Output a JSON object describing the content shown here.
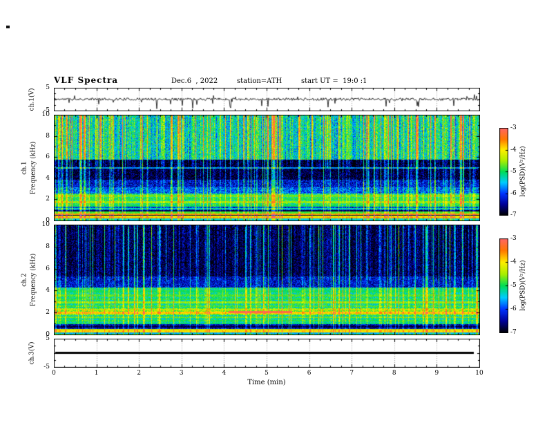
{
  "header": {
    "title": "VLF Spectra",
    "date": "Dec.6  , 2022",
    "station": "station=ATH",
    "start_ut": "start UT =  19:0 :1"
  },
  "x_axis": {
    "label": "Time  (min)",
    "ticks": [
      "0",
      "1",
      "2",
      "3",
      "4",
      "5",
      "6",
      "7",
      "8",
      "9",
      "10"
    ],
    "range": [
      0,
      10
    ]
  },
  "panels": {
    "ch1_wave": {
      "ylabel": "ch.1(V)",
      "yticks": [
        5,
        -5
      ],
      "y_range": [
        -5,
        5
      ]
    },
    "ch1_spec": {
      "ylabel_channel": "ch.1",
      "ylabel_axis": "Frequency (kHz)",
      "yticks": [
        10,
        8,
        6,
        4,
        2,
        0
      ],
      "y_range": [
        0,
        10
      ]
    },
    "ch2_spec": {
      "ylabel_channel": "ch.2",
      "ylabel_axis": "Frequency (kHz)",
      "yticks": [
        10,
        8,
        6,
        4,
        2,
        0
      ],
      "y_range": [
        0,
        10
      ]
    },
    "ch3_wave": {
      "ylabel": "ch.3(V)",
      "yticks": [
        5,
        -5
      ],
      "y_range": [
        -5,
        5
      ]
    }
  },
  "colorbar": {
    "label": "log(PSD)(V²/Hz)",
    "ticks": [
      -3,
      -4,
      -5,
      -6,
      -7
    ],
    "range": [
      -7,
      -3
    ]
  },
  "colors": {
    "background": "#ffffff",
    "frame": "#000000",
    "trace": "#000000",
    "grid_dotted": "#999999",
    "colormap_stops": [
      {
        "t": 0.0,
        "c": "#000000"
      },
      {
        "t": 0.125,
        "c": "#000099"
      },
      {
        "t": 0.25,
        "c": "#0033ff"
      },
      {
        "t": 0.375,
        "c": "#00ccff"
      },
      {
        "t": 0.5,
        "c": "#00dd55"
      },
      {
        "t": 0.625,
        "c": "#aaee00"
      },
      {
        "t": 0.75,
        "c": "#ffee00"
      },
      {
        "t": 0.875,
        "c": "#ff7700"
      },
      {
        "t": 1.0,
        "c": "#ff6666"
      }
    ]
  },
  "chart_data": [
    {
      "type": "line",
      "panel": "ch.1(V)",
      "x_range_min": [
        0,
        10
      ],
      "y_range_v": [
        -5,
        5
      ],
      "description": "Channel-1 broadband voltage: noise band around 0 V with frequent impulsive sferic spikes, mostly negative, reaching about -4 V",
      "baseline": 0,
      "noise_amplitude": 0.55,
      "spike_probability": 0.035,
      "spike_depth_range": [
        1.2,
        4.0
      ],
      "upspike_probability": 0.015,
      "upspike_height_range": [
        0.8,
        2.0
      ],
      "seed": 11
    },
    {
      "type": "heatmap",
      "panel": "ch.1 spectrogram",
      "x_range_min": [
        0,
        10
      ],
      "freq_range_khz": [
        0,
        10
      ],
      "z_label": "log(PSD)(V²/Hz)",
      "z_range": [
        -7,
        -3
      ],
      "description": "Green/cyan speckle above ~6 kHz with dense vertical sferic streaks; dark blue/black quiet band ~4-6 kHz; bright green band ~1.6-2.6 kHz; layered narrow horizontal lines (some red/yellow) below 1 kHz",
      "bands": [
        {
          "f": [
            5.8,
            10.01
          ],
          "level": -5.25
        },
        {
          "f": [
            3.9,
            5.8
          ],
          "level": -6.85
        },
        {
          "f": [
            3.2,
            3.9
          ],
          "level": -6.3
        },
        {
          "f": [
            2.55,
            3.2
          ],
          "level": -5.9
        },
        {
          "f": [
            1.55,
            2.55
          ],
          "level": -5.05
        },
        {
          "f": [
            0.95,
            1.55
          ],
          "level": -6.1
        },
        {
          "f": [
            0.45,
            0.95
          ],
          "level": -5.5
        },
        {
          "f": [
            0.0,
            0.45
          ],
          "level": -5.2
        }
      ],
      "lines": [
        {
          "f": 5.0,
          "level": -5.7
        },
        {
          "f": 2.35,
          "level": -4.7
        },
        {
          "f": 2.05,
          "level": -4.9
        },
        {
          "f": 1.75,
          "level": -4.55
        },
        {
          "f": 1.45,
          "level": -5.0
        },
        {
          "f": 1.15,
          "level": -5.3
        },
        {
          "f": 0.95,
          "level": -6.8
        },
        {
          "f": 0.8,
          "level": -4.8
        },
        {
          "f": 0.62,
          "level": -3.7
        },
        {
          "f": 0.5,
          "level": -6.9
        },
        {
          "f": 0.38,
          "level": -4.2
        },
        {
          "f": 0.25,
          "level": -3.8
        },
        {
          "f": 0.12,
          "level": -5.4
        }
      ],
      "streaks": {
        "probability": 0.24,
        "boost_min": 0.5,
        "boost_max": 2.3,
        "top_weight": 1.0,
        "bottom_weight": 0.55
      },
      "pixel_noise": 0.55,
      "column_variation": 0.5,
      "seed": 42
    },
    {
      "type": "heatmap",
      "panel": "ch.2 spectrogram",
      "x_range_min": [
        0,
        10
      ],
      "freq_range_khz": [
        0,
        10
      ],
      "z_label": "log(PSD)(V²/Hz)",
      "z_range": [
        -7,
        -3
      ],
      "description": "Dark blue/black background above ~5 kHz crossed by many cyan/green vertical sferic streaks; green band with yellow horizontal lines 2.5-4 kHz; strong yellow band near 2 kHz with a red segment around 4-5.6 min; dark band 0.55-1 kHz; bright layered lines below 0.5 kHz",
      "bands": [
        {
          "f": [
            5.3,
            10.01
          ],
          "level": -6.75
        },
        {
          "f": [
            4.3,
            5.3
          ],
          "level": -6.3
        },
        {
          "f": [
            2.45,
            4.3
          ],
          "level": -5.15
        },
        {
          "f": [
            1.8,
            2.45
          ],
          "level": -4.6
        },
        {
          "f": [
            1.0,
            1.8
          ],
          "level": -5.2
        },
        {
          "f": [
            0.55,
            1.0
          ],
          "level": -6.35
        },
        {
          "f": [
            0.0,
            0.55
          ],
          "level": -5.0
        }
      ],
      "lines": [
        {
          "f": 3.95,
          "level": -5.0
        },
        {
          "f": 3.6,
          "level": -4.8
        },
        {
          "f": 3.25,
          "level": -4.9
        },
        {
          "f": 2.95,
          "level": -4.6
        },
        {
          "f": 2.6,
          "level": -4.8
        },
        {
          "f": 2.3,
          "level": -4.45
        },
        {
          "f": 2.0,
          "level": -3.85
        },
        {
          "f": 2.08,
          "level": -3.2,
          "x_range": [
            4.1,
            5.6
          ]
        },
        {
          "f": 1.6,
          "level": -4.7
        },
        {
          "f": 1.3,
          "level": -4.9
        },
        {
          "f": 1.05,
          "level": -5.1
        },
        {
          "f": 0.75,
          "level": -6.8
        },
        {
          "f": 0.45,
          "level": -4.3
        },
        {
          "f": 0.3,
          "level": -3.95
        },
        {
          "f": 0.15,
          "level": -5.6
        }
      ],
      "streaks": {
        "probability": 0.2,
        "boost_min": 0.4,
        "boost_max": 2.0,
        "top_weight": 1.0,
        "bottom_weight": 0.5
      },
      "pixel_noise": 0.5,
      "column_variation": 0.3,
      "seed": 77
    },
    {
      "type": "line",
      "panel": "ch.3(V)",
      "x_range_min": [
        0,
        10
      ],
      "y_range_v": [
        -5,
        5
      ],
      "constant_value": 0,
      "description": "Channel-3 voltage flat at 0 V across the whole interval (thick black line)",
      "seed": 5
    }
  ]
}
